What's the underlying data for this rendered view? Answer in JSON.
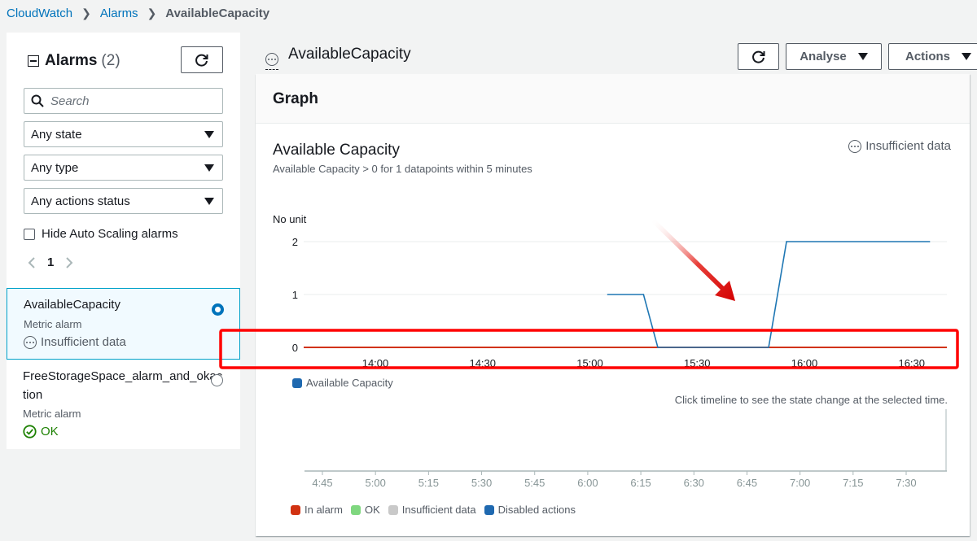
{
  "breadcrumb": [
    "CloudWatch",
    "Alarms",
    "AvailableCapacity"
  ],
  "sidebar": {
    "title": "Alarms",
    "count": "(2)",
    "search_placeholder": "Search",
    "filters": [
      "Any state",
      "Any type",
      "Any actions status"
    ],
    "hide_autoscaling_label": "Hide Auto Scaling alarms",
    "page": "1",
    "alarms": [
      {
        "name": "AvailableCapacity",
        "type": "Metric alarm",
        "status": "Insufficient data",
        "selected": true
      },
      {
        "name_line1": "FreeStorageSpace_alarm_and_okac",
        "name_line2": "tion",
        "type": "Metric alarm",
        "status": "OK",
        "selected": false
      }
    ]
  },
  "header": {
    "title": "AvailableCapacity",
    "analyse_label": "Analyse",
    "actions_label": "Actions"
  },
  "graph": {
    "section_title": "Graph",
    "metric_title": "Available Capacity",
    "metric_subtitle": "Available Capacity > 0 for 1 datapoints within 5 minutes",
    "state": "Insufficient data",
    "unit_label": "No unit",
    "legend": "Available Capacity",
    "hint": "Click timeline to see the state change at the selected time.",
    "timeline_legend": [
      "In alarm",
      "OK",
      "Insufficient data",
      "Disabled actions"
    ]
  },
  "colors": {
    "link": "#0073bb",
    "series": "#1f77b4",
    "threshold": "#d13212",
    "highlight_box": "#ff0000",
    "in_alarm": "#d13212",
    "ok": "#7fd77f",
    "insufficient": "#c9c9c9",
    "disabled": "#1f69b0"
  },
  "chart_data": {
    "type": "line",
    "xlabel": "",
    "ylabel": "No unit",
    "x_ticks": [
      "14:00",
      "14:30",
      "15:00",
      "15:30",
      "16:00",
      "16:30"
    ],
    "y_ticks": [
      0,
      1,
      2
    ],
    "ylim": [
      0,
      2
    ],
    "series": [
      {
        "name": "Available Capacity",
        "x": [
          "15:05",
          "15:15",
          "15:19",
          "15:50",
          "15:55",
          "16:35"
        ],
        "values": [
          1,
          1,
          0,
          0,
          2,
          2
        ]
      }
    ],
    "threshold": 0
  },
  "timeline": {
    "x_ticks": [
      "4:45",
      "5:00",
      "5:15",
      "5:30",
      "5:45",
      "6:00",
      "6:15",
      "6:30",
      "6:45",
      "7:00",
      "7:15",
      "7:30"
    ]
  }
}
